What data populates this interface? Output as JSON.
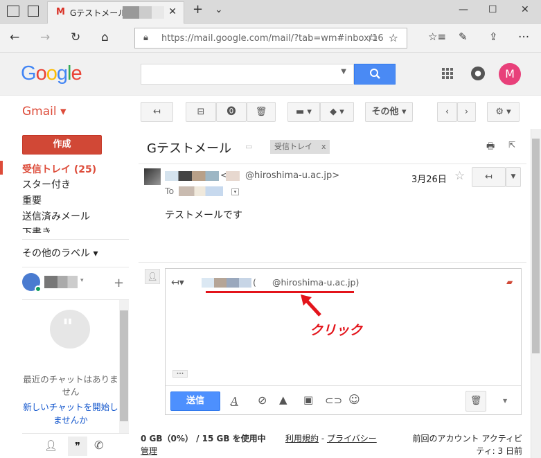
{
  "browser": {
    "tab_title": "Gテストメール -",
    "url": "https://mail.google.com/mail/?tab=wm#inbox/16"
  },
  "header": {
    "logo": "Google",
    "avatar_letter": "M"
  },
  "gmail_label": "Gmail ▾",
  "toolbar": {
    "more_label": "その他 ▾"
  },
  "sidebar": {
    "compose": "作成",
    "items": [
      "受信トレイ (25)",
      "スター付き",
      "重要",
      "送信済みメール",
      "下書き"
    ],
    "more_labels": "その他のラベル ▾",
    "chat_text": "最近のチャットはありません",
    "chat_link": "新しいチャットを開始しませんか"
  },
  "message": {
    "subject": "Gテストメール",
    "label_chip": "受信トレイ",
    "label_chip_close": "x",
    "sender_email": "@hiroshima-u.ac.jp>",
    "to_label": "To",
    "date": "3月26日",
    "body": "テストメールです"
  },
  "reply": {
    "recipient_email": "@hiroshima-u.ac.jp)",
    "annotation": "クリック",
    "ellipsis": "•••",
    "send": "送信"
  },
  "footer": {
    "storage": "0 GB（0%） / 15 GB を使用中",
    "manage": "管理",
    "terms": "利用規約",
    "dash": " - ",
    "privacy": "プライバシー",
    "activity": "前回のアカウント アクティビティ: 3 日前"
  },
  "colors": {
    "accent_red": "#dd4b39",
    "blue": "#4d90fe",
    "annotation": "#e3141b"
  }
}
